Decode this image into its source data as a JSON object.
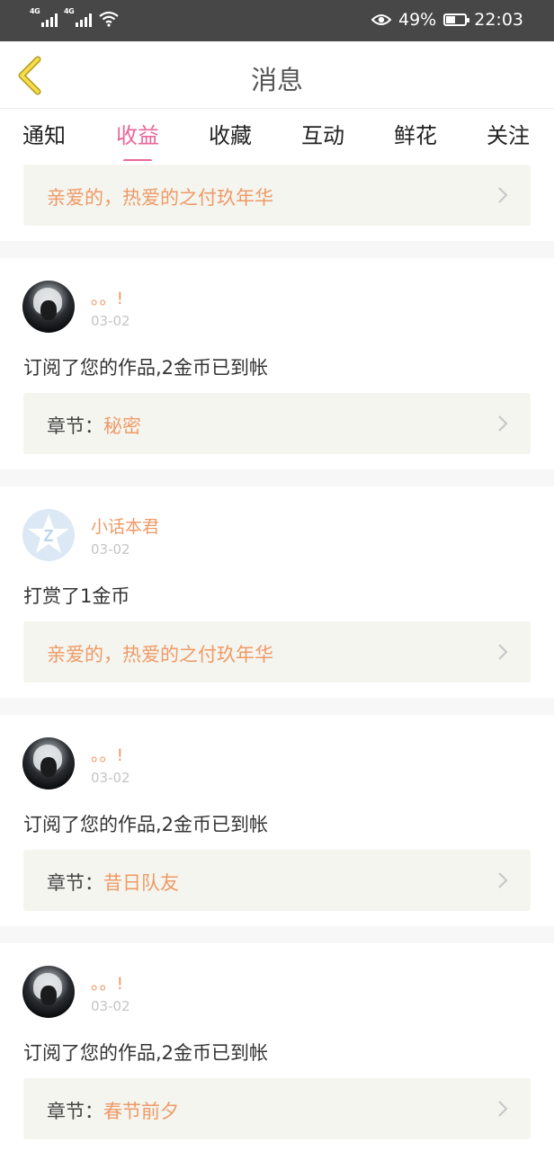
{
  "status_bar": {
    "signal_1": "4G",
    "signal_2": "4G",
    "battery_percent": "49%",
    "time": "22:03",
    "icons": [
      "signal-icon",
      "signal-icon",
      "wifi-icon",
      "eye-icon",
      "battery-icon"
    ]
  },
  "header": {
    "title": "消息",
    "back_icon": "chevron-left-icon"
  },
  "tabs": [
    {
      "label": "通知",
      "active": false
    },
    {
      "label": "收益",
      "active": true
    },
    {
      "label": "收藏",
      "active": false
    },
    {
      "label": "互动",
      "active": false
    },
    {
      "label": "鲜花",
      "active": false
    },
    {
      "label": "关注",
      "active": false
    }
  ],
  "top_item": {
    "title": "亲爱的，热爱的之付玖年华"
  },
  "messages": [
    {
      "user": "。。!",
      "date": "03-02",
      "text": "订阅了您的作品,2金币已到帐",
      "chapter_label": "章节：",
      "chapter": "秘密"
    },
    {
      "user": "小话本君",
      "date": "03-02",
      "text": "打赏了1金币",
      "work": "亲爱的，热爱的之付玖年华"
    },
    {
      "user": "。。!",
      "date": "03-02",
      "text": "订阅了您的作品,2金币已到帐",
      "chapter_label": "章节：",
      "chapter": "昔日队友"
    },
    {
      "user": "。。!",
      "date": "03-02",
      "text": "订阅了您的作品,2金币已到帐",
      "chapter_label": "章节：",
      "chapter": "春节前夕"
    }
  ],
  "colors": {
    "accent": "#e9679a",
    "link": "#ee9a67",
    "status_bar": "#474747"
  }
}
